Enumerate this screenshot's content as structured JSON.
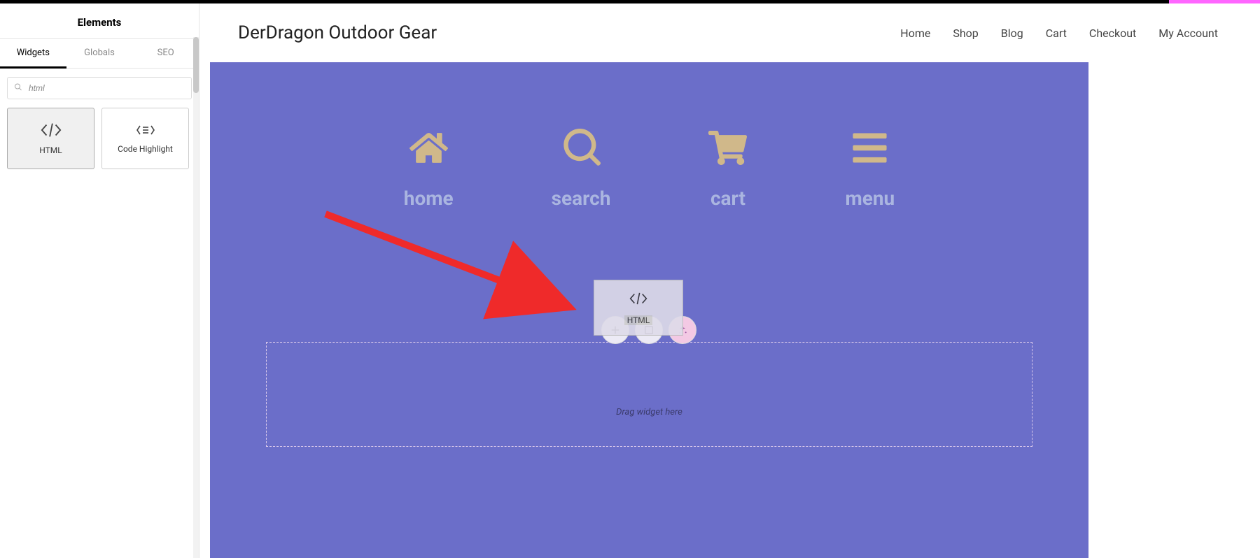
{
  "sidebar": {
    "title": "Elements",
    "tabs": [
      "Widgets",
      "Globals",
      "SEO"
    ],
    "active_tab": 0,
    "search_value": "html",
    "widgets": [
      {
        "label": "HTML",
        "icon": "code-icon",
        "selected": true
      },
      {
        "label": "Code Highlight",
        "icon": "code-highlight-icon",
        "selected": false
      }
    ]
  },
  "site": {
    "title": "DerDragon Outdoor Gear",
    "nav": [
      "Home",
      "Shop",
      "Blog",
      "Cart",
      "Checkout",
      "My Account"
    ]
  },
  "hero_icons": [
    {
      "label": "home",
      "icon": "home-icon"
    },
    {
      "label": "search",
      "icon": "search-icon"
    },
    {
      "label": "cart",
      "icon": "cart-icon"
    },
    {
      "label": "menu",
      "icon": "menu-icon"
    }
  ],
  "dropzone": {
    "placeholder": "Drag widget here",
    "ghost_label": "HTML"
  },
  "collapse_glyph": "‹",
  "colors": {
    "hero_bg": "#6b6ec9",
    "icon_gold": "#d0b88a",
    "label_blue": "#aab5e0",
    "arrow": "#ef2a2a"
  }
}
